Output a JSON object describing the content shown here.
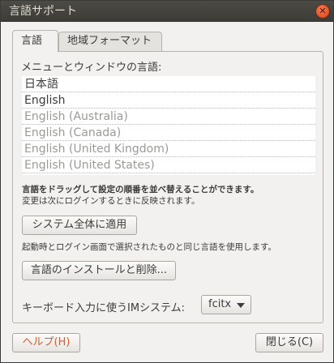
{
  "window": {
    "title": "言語サポート"
  },
  "tabs": [
    {
      "label": "言語",
      "active": true
    },
    {
      "label": "地域フォーマット",
      "active": false
    }
  ],
  "language_list": {
    "label": "メニューとウィンドウの言語:",
    "items": [
      {
        "label": "日本語",
        "active": true
      },
      {
        "label": "English",
        "active": true
      },
      {
        "label": "English (Australia)",
        "active": false
      },
      {
        "label": "English (Canada)",
        "active": false
      },
      {
        "label": "English (United Kingdom)",
        "active": false
      },
      {
        "label": "English (United States)",
        "active": false
      }
    ]
  },
  "hints": {
    "drag": "言語をドラッグして設定の順番を並べ替えることができます。",
    "effect": "変更は次にログインするときに反映されます。"
  },
  "apply_system_wide": {
    "button": "システム全体に適用",
    "description": "起動時とログイン画面で選択されたものと同じ言語を使用します。"
  },
  "install_remove_button": "言語のインストールと削除...",
  "im_system": {
    "label": "キーボード入力に使うIMシステム:",
    "selected": "fcitx"
  },
  "footer": {
    "help_button": "ヘルプ(H)",
    "close_button": "閉じる(C)"
  },
  "colors": {
    "titlebar": "#3c3b37",
    "close_button": "#e0552b",
    "help_text": "#e05a2b",
    "background": "#f2f1f0"
  },
  "icons": {
    "window_close": "close-icon",
    "dropdown": "chevron-down-icon"
  }
}
